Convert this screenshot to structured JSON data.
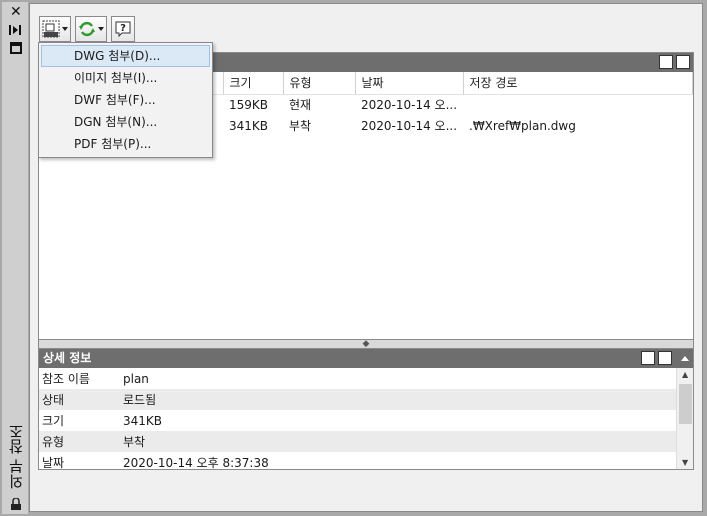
{
  "strip": {
    "title": "외부 참조",
    "close_icon": "close-icon",
    "autohide_icon": "autohide-icon",
    "properties_icon": "properties-icon",
    "lock_icon": "lock-icon"
  },
  "toolbar": {
    "attach_icon": "attach-dwg-icon",
    "refresh_icon": "refresh-icon",
    "help_icon": "help-icon",
    "help_glyph": "?"
  },
  "menu": {
    "items": [
      {
        "label": "DWG 첨부(D)...",
        "highlighted": true
      },
      {
        "label": "이미지 첨부(I)..."
      },
      {
        "label": "DWF 첨부(F)..."
      },
      {
        "label": "DGN 첨부(N)..."
      },
      {
        "label": "PDF 첨부(P)..."
      }
    ]
  },
  "refs": {
    "columns": [
      "크기",
      "유형",
      "날짜",
      "저장 경로"
    ],
    "rows": [
      {
        "size": "159KB",
        "type": "현재",
        "date": "2020-10-14 오...",
        "path": ""
      },
      {
        "size": "341KB",
        "type": "부착",
        "date": "2020-10-14 오...",
        "path": ".₩Xref₩plan.dwg"
      }
    ]
  },
  "details": {
    "title": "상세 정보",
    "rows": [
      {
        "key": "참조 이름",
        "value": "plan"
      },
      {
        "key": "상태",
        "value": "로드됨"
      },
      {
        "key": "크기",
        "value": "341KB"
      },
      {
        "key": "유형",
        "value": "부착"
      },
      {
        "key": "날짜",
        "value": "2020-10-14 오후 8:37:38"
      }
    ]
  },
  "colors": {
    "header_bar": "#6e6e6e",
    "menu_highlight": "#dbe9f7",
    "refresh_green": "#2e9a2e"
  }
}
